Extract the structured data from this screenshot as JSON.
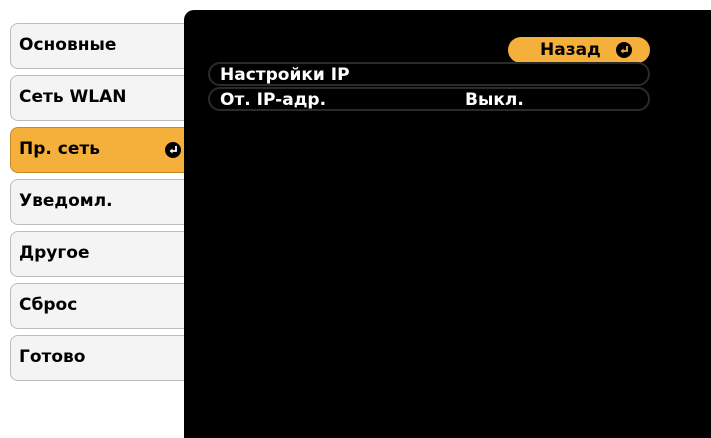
{
  "menu": {
    "items": [
      {
        "label": "Основные"
      },
      {
        "label": "Сеть WLAN"
      },
      {
        "label": "Пр. сеть"
      },
      {
        "label": "Уведомл."
      },
      {
        "label": "Другое"
      },
      {
        "label": "Сброс"
      },
      {
        "label": "Готово"
      }
    ],
    "selected": "Пр. сеть"
  },
  "panel": {
    "back_label": "Назад",
    "rows": [
      {
        "label": "Настройки IP",
        "value": ""
      },
      {
        "label": "От. IP-адр.",
        "value": "Выкл."
      }
    ]
  },
  "colors": {
    "accent": "#f5b03c",
    "panel_bg": "#000000",
    "menu_bg": "#f4f4f4"
  },
  "icons": {
    "enter": "enter-icon"
  }
}
